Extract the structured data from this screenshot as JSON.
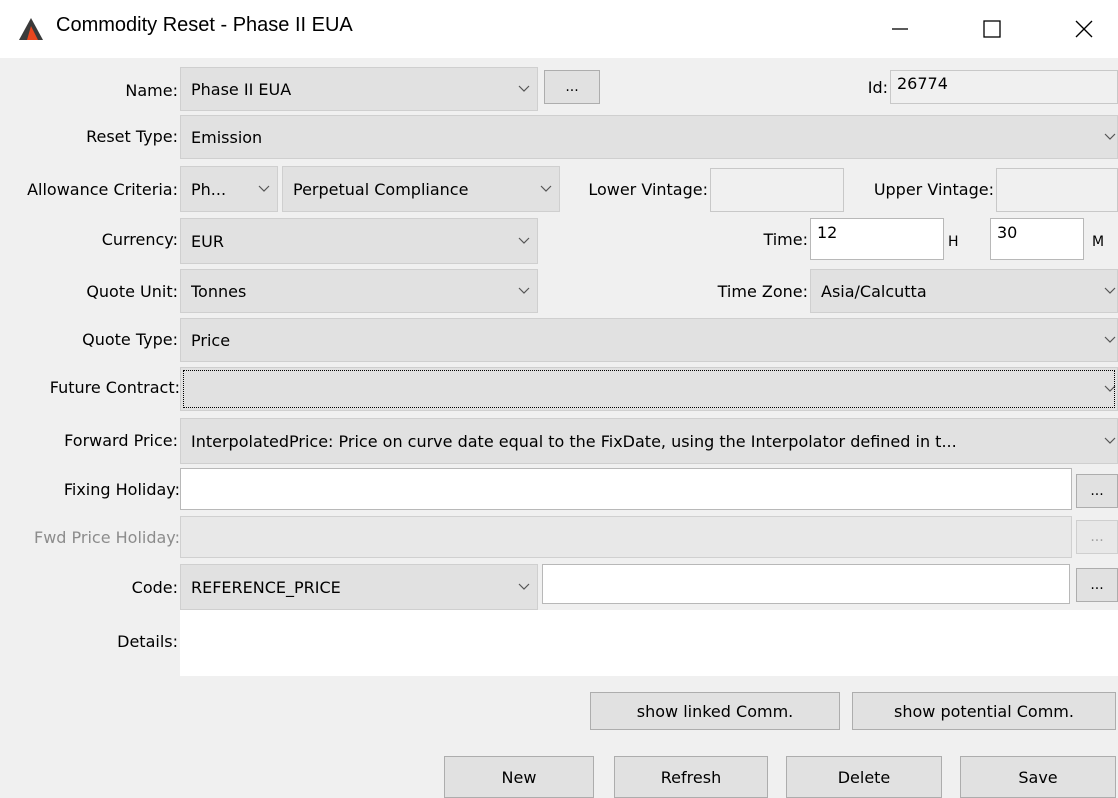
{
  "window": {
    "title": "Commodity Reset - Phase II EUA",
    "icon": "app-logo-icon",
    "minimize_icon": "minimize-icon",
    "maximize_icon": "maximize-icon",
    "close_icon": "close-icon"
  },
  "form": {
    "name": {
      "label": "Name:",
      "value": "Phase II EUA",
      "browse_label": "..."
    },
    "id": {
      "label": "Id:",
      "value": "26774"
    },
    "reset_type": {
      "label": "Reset Type:",
      "value": "Emission"
    },
    "allowance_criteria": {
      "label": "Allowance Criteria:",
      "value1": "Ph...",
      "value2": "Perpetual Compliance"
    },
    "lower_vintage": {
      "label": "Lower Vintage:",
      "value": ""
    },
    "upper_vintage": {
      "label": "Upper Vintage:",
      "value": ""
    },
    "currency": {
      "label": "Currency:",
      "value": "EUR"
    },
    "time": {
      "label": "Time:",
      "hour": "12",
      "hour_unit": "H",
      "minute": "30",
      "minute_unit": "M"
    },
    "quote_unit": {
      "label": "Quote Unit:",
      "value": "Tonnes"
    },
    "time_zone": {
      "label": "Time Zone:",
      "value": "Asia/Calcutta"
    },
    "quote_type": {
      "label": "Quote Type:",
      "value": "Price"
    },
    "future_contract": {
      "label": "Future Contract:",
      "value": ""
    },
    "forward_price": {
      "label": "Forward Price:",
      "value": "InterpolatedPrice: Price on curve date equal to the FixDate, using the Interpolator defined in t..."
    },
    "fixing_holiday": {
      "label": "Fixing Holiday:",
      "value": "",
      "browse_label": "..."
    },
    "fwd_price_holiday": {
      "label": "Fwd Price Holiday:",
      "value": "",
      "browse_label": "..."
    },
    "code": {
      "label": "Code:",
      "value": "REFERENCE_PRICE",
      "text_value": "",
      "browse_label": "..."
    },
    "details": {
      "label": "Details:",
      "value": ""
    }
  },
  "buttons": {
    "show_linked": "show linked Comm.",
    "show_potential": "show potential Comm.",
    "new": "New",
    "refresh": "Refresh",
    "delete": "Delete",
    "save": "Save"
  },
  "colors": {
    "logo_dark": "#3a3a3a",
    "logo_accent": "#e8461e",
    "combo_bg": "#e1e1e1",
    "window_bg": "#f0f0f0"
  }
}
